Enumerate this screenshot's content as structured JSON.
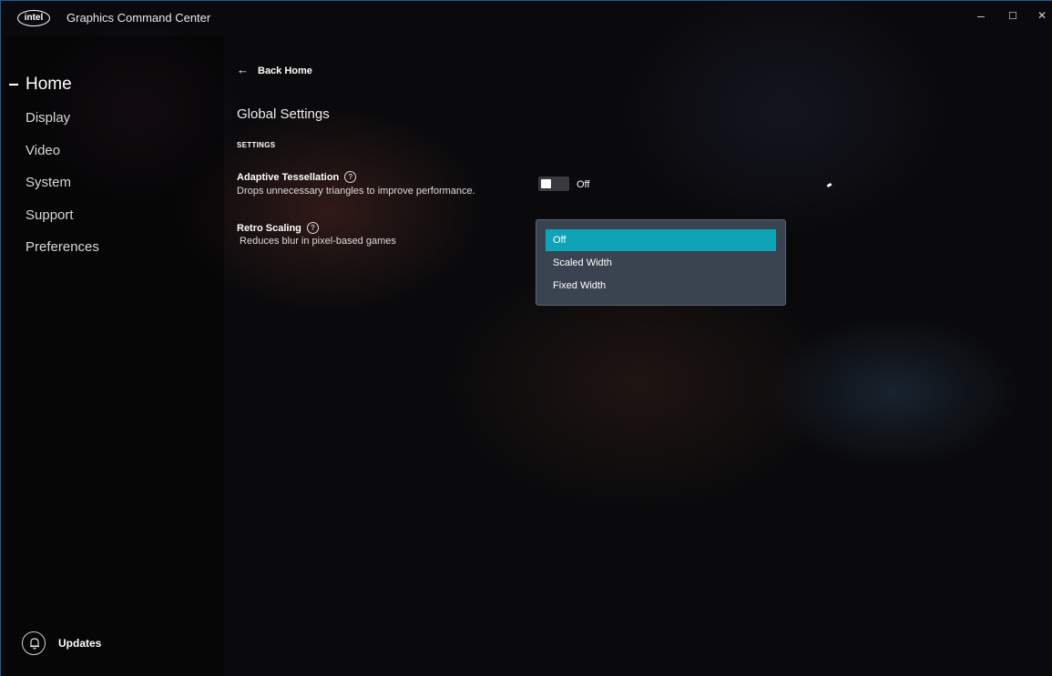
{
  "app": {
    "brand": "intel",
    "title": "Graphics Command Center",
    "window_controls": {
      "minimize": "–",
      "maximize": "☐",
      "close": "✕"
    }
  },
  "sidebar": {
    "items": [
      {
        "label": "Home",
        "active": true
      },
      {
        "label": "Display"
      },
      {
        "label": "Video"
      },
      {
        "label": "System"
      },
      {
        "label": "Support"
      },
      {
        "label": "Preferences"
      }
    ],
    "updates_label": "Updates"
  },
  "main": {
    "back_label": "Back Home",
    "back_arrow": "←",
    "page_title": "Global Settings",
    "section_label": "SETTINGS",
    "settings": [
      {
        "title": "Adaptive Tessellation",
        "help": "?",
        "description": "Drops unnecessary triangles to improve performance.",
        "control": "toggle",
        "value": "Off"
      },
      {
        "title": "Retro Scaling",
        "help": "?",
        "description": " Reduces blur in pixel-based games",
        "control": "dropdown",
        "options": [
          "Off",
          "Scaled Width",
          "Fixed Width"
        ],
        "selected": "Off"
      }
    ]
  },
  "colors": {
    "accent": "#0fa3b8",
    "dropdown_bg": "#3a4350",
    "window_border": "#1e5a9a"
  }
}
